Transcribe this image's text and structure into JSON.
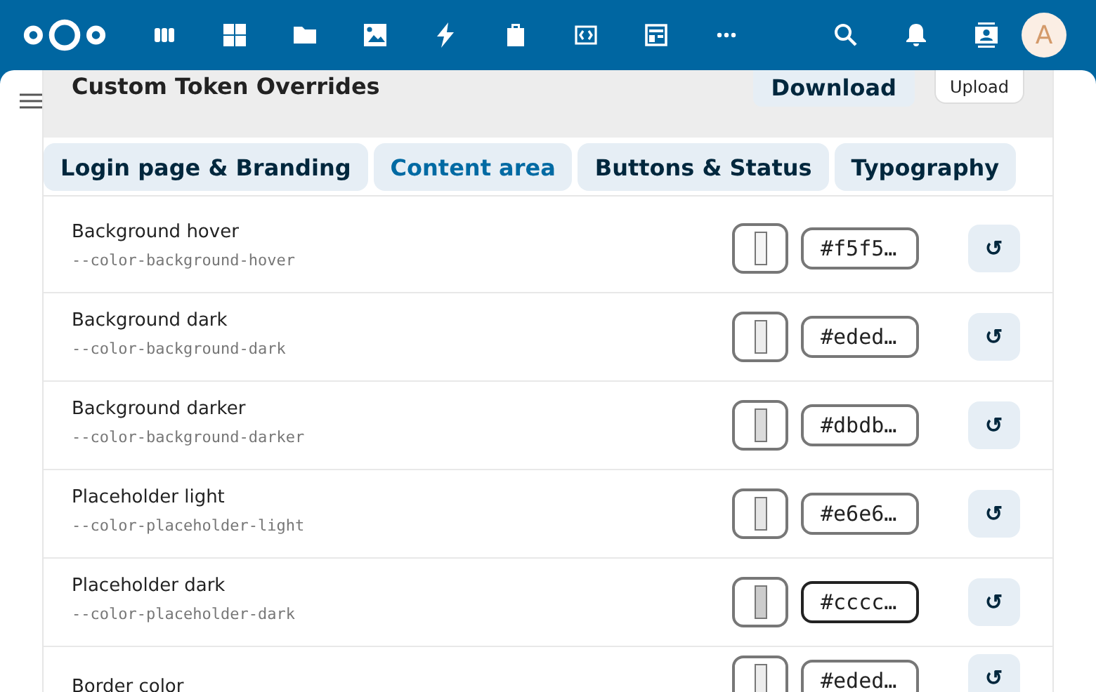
{
  "header": {
    "avatar_letter": "A"
  },
  "panel": {
    "title": "Custom Token Overrides",
    "buttons": [
      {
        "label": "Download",
        "kind": "primary"
      },
      {
        "label": "Upload",
        "kind": "secondary"
      }
    ]
  },
  "tabs": [
    {
      "label": "Login page & Branding",
      "selected": false
    },
    {
      "label": "Content area",
      "selected": true
    },
    {
      "label": "Buttons & Status",
      "selected": false
    },
    {
      "label": "Typography",
      "selected": false
    }
  ],
  "tokens": [
    {
      "name": "Background hover",
      "token": "--color-background-hover",
      "value": "#f5f5…",
      "color": "#f5f5f5",
      "focused": false
    },
    {
      "name": "Background dark",
      "token": "--color-background-dark",
      "value": "#eded…",
      "color": "#ededed",
      "focused": false
    },
    {
      "name": "Background darker",
      "token": "--color-background-darker",
      "value": "#dbdb…",
      "color": "#dbdbdb",
      "focused": false
    },
    {
      "name": "Placeholder light",
      "token": "--color-placeholder-light",
      "value": "#e6e6…",
      "color": "#e6e6e6",
      "focused": false
    },
    {
      "name": "Placeholder dark",
      "token": "--color-placeholder-dark",
      "value": "#cccc…",
      "color": "#cccccc",
      "focused": true
    },
    {
      "name": "Border color",
      "value": "#eded…",
      "color": "#ededed",
      "focused": false
    }
  ],
  "reset_symbol": "↺"
}
